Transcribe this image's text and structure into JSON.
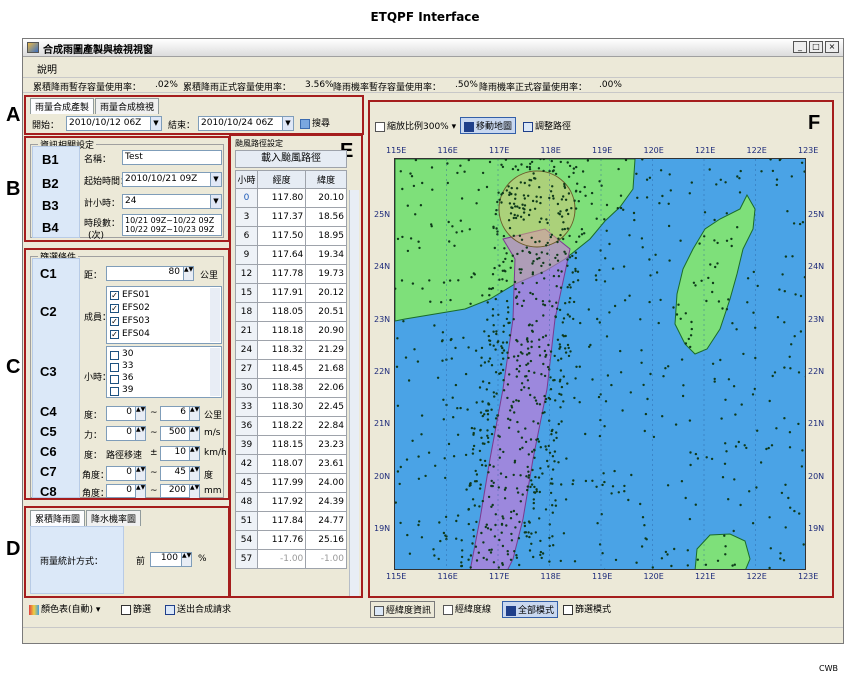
{
  "figure": {
    "title": "ETQPF Interface",
    "credit": "CWB"
  },
  "window": {
    "title": "合成雨圖產製與檢視視窗",
    "controls": [
      "_",
      "□",
      "×"
    ],
    "menu": [
      "說明"
    ]
  },
  "usage": [
    {
      "label": "累積降雨暫存容量使用率：",
      "value": ".02%"
    },
    {
      "label": "累積降雨正式容量使用率：",
      "value": "3.56%"
    },
    {
      "label": "降雨機率暫存容量使用率：",
      "value": ".50%"
    },
    {
      "label": "降雨機率正式容量使用率：",
      "value": ".00%"
    }
  ],
  "section_labels": {
    "A": "A",
    "B": "B",
    "C": "C",
    "D": "D",
    "E": "E",
    "F": "F"
  },
  "panel_a": {
    "tabs": [
      "雨量合成產製",
      "雨量合成檢視"
    ],
    "start_label": "開始：",
    "start_value": "2010/10/12 06Z",
    "end_label": "結束：",
    "end_value": "2010/10/24 06Z",
    "search_label": "搜尋"
  },
  "panel_b": {
    "group_title": "資訊相關設定",
    "labels": [
      "B1",
      "B2",
      "B3",
      "B4"
    ],
    "name_label": "名稱：",
    "name_value": "Test",
    "start_label": "起始時間：",
    "start_value": "2010/10/21 09Z",
    "hours_label": "計小時：",
    "hours_value": "24",
    "period_label": "時段數：",
    "period_label_2": "(次)",
    "periods": [
      "10/21 09Z~10/22 09Z",
      "10/22 09Z~10/23 09Z"
    ]
  },
  "panel_c": {
    "group_title": "篩選條件",
    "labels": [
      "C1",
      "C2",
      "C3",
      "C4",
      "C5",
      "C6",
      "C7",
      "C8"
    ],
    "distance": {
      "label": "距：",
      "value": "80",
      "unit": "公里"
    },
    "ensemble_label": "成員：",
    "members": [
      {
        "name": "EFS01",
        "checked": true
      },
      {
        "name": "EFS02",
        "checked": true
      },
      {
        "name": "EFS03",
        "checked": true
      },
      {
        "name": "EFS04",
        "checked": true
      }
    ],
    "hours_label": "小時：",
    "hour_options": [
      "30",
      "33",
      "36",
      "39"
    ],
    "c4": {
      "label": "度：",
      "from": "0",
      "to": "6",
      "unit": "公里"
    },
    "c5": {
      "label": "力：",
      "from": "0",
      "to": "500",
      "unit": "m/s"
    },
    "c6": {
      "label": "度：",
      "mode": "路徑移速",
      "sign": "±",
      "value": "10",
      "unit": "km/h"
    },
    "c7": {
      "label": "角度：",
      "from": "0",
      "to": "45",
      "unit": "度"
    },
    "c8": {
      "label": "角度：",
      "from": "0",
      "to": "200",
      "unit": "mm"
    },
    "range_sep": "~"
  },
  "panel_d": {
    "tabs": [
      "累積降雨圖",
      "降水機率圖"
    ],
    "method_label": "雨量統計方式：",
    "prefix": "前",
    "value": "100",
    "unit": "%"
  },
  "panel_e": {
    "title": "颱風路徑設定",
    "load_button": "載入颱風路徑",
    "headers": [
      "小時",
      "經度",
      "緯度"
    ],
    "rows": [
      [
        "0",
        "117.80",
        "20.10"
      ],
      [
        "3",
        "117.37",
        "18.56"
      ],
      [
        "6",
        "117.50",
        "18.95"
      ],
      [
        "9",
        "117.64",
        "19.34"
      ],
      [
        "12",
        "117.78",
        "19.73"
      ],
      [
        "15",
        "117.91",
        "20.12"
      ],
      [
        "18",
        "118.05",
        "20.51"
      ],
      [
        "21",
        "118.18",
        "20.90"
      ],
      [
        "24",
        "118.32",
        "21.29"
      ],
      [
        "27",
        "118.45",
        "21.68"
      ],
      [
        "30",
        "118.38",
        "22.06"
      ],
      [
        "33",
        "118.30",
        "22.45"
      ],
      [
        "36",
        "118.22",
        "22.84"
      ],
      [
        "39",
        "118.15",
        "23.23"
      ],
      [
        "42",
        "118.07",
        "23.61"
      ],
      [
        "45",
        "117.99",
        "24.00"
      ],
      [
        "48",
        "117.92",
        "24.39"
      ],
      [
        "51",
        "117.84",
        "24.77"
      ],
      [
        "54",
        "117.76",
        "25.16"
      ],
      [
        "57",
        "-1.00",
        "-1.00"
      ]
    ]
  },
  "panel_f": {
    "zoom_label": "縮放比例300%",
    "move_button": "移動地圖",
    "adjust_button": "調整路徑",
    "lon_ticks": [
      "115E",
      "116E",
      "117E",
      "118E",
      "119E",
      "120E",
      "121E",
      "122E",
      "123E"
    ],
    "lat_ticks": [
      "25N",
      "24N",
      "23N",
      "22N",
      "21N",
      "20N",
      "19N"
    ],
    "colors": {
      "sea": "#4aa3e6",
      "land": "#7ee07a",
      "track": "#c87ad8",
      "points": "#0e3a1a"
    }
  },
  "bottom_left": {
    "color_table": "顏色表(自動)",
    "filter": "篩選",
    "send": "送出合成請求"
  },
  "bottom_right": {
    "latlon_info": "經緯度資訊",
    "latlon_lines": "經緯度線",
    "all_mode": "全部模式",
    "filter_mode": "篩選模式"
  }
}
